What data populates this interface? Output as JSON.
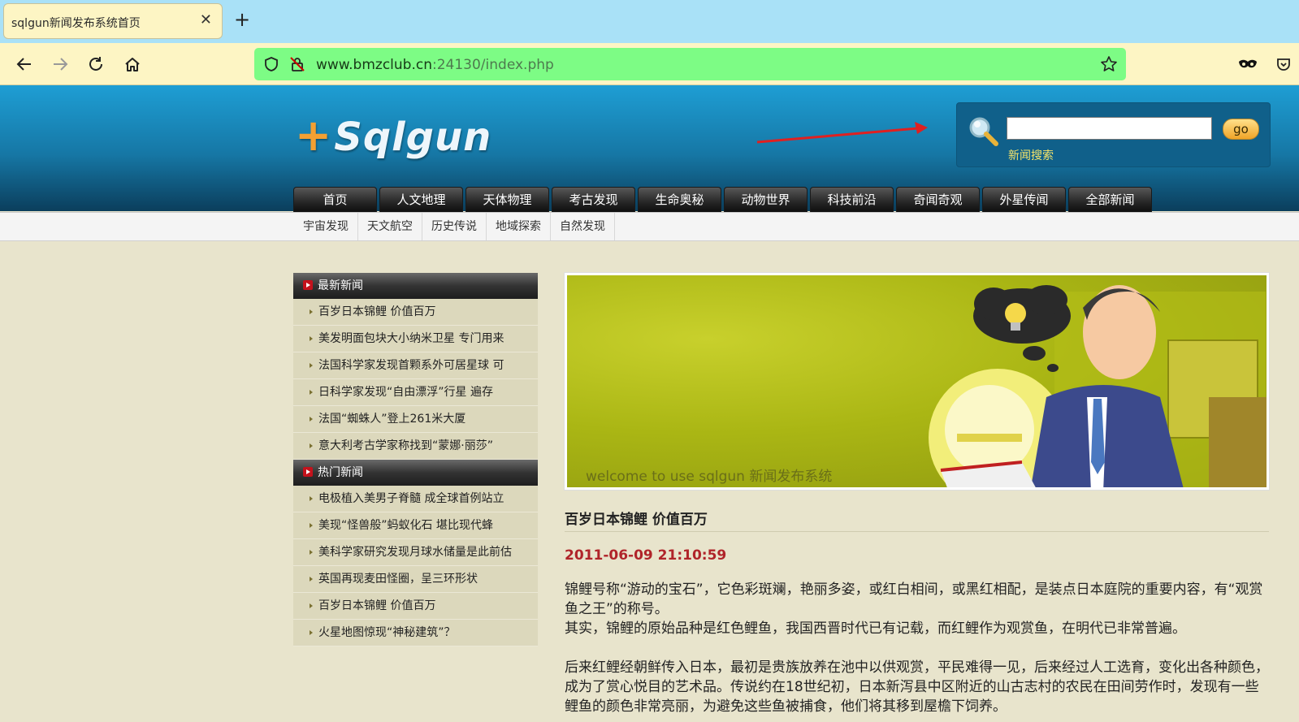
{
  "browser": {
    "tab_title": "sqlgun新闻发布系统首页",
    "tab_close": "✕",
    "new_tab": "+",
    "url_host": "www.bmzclub.cn",
    "url_rest": ":24130/index.php"
  },
  "header": {
    "logo_text": "Sqlgun",
    "logo_plus": "+",
    "search_button": "go",
    "search_label": "新闻搜索",
    "search_value": ""
  },
  "main_nav": [
    "首页",
    "人文地理",
    "天体物理",
    "考古发现",
    "生命奥秘",
    "动物世界",
    "科技前沿",
    "奇闻奇观",
    "外星传闻",
    "全部新闻"
  ],
  "sub_nav": [
    "宇宙发现",
    "天文航空",
    "历史传说",
    "地域探索",
    "自然发现"
  ],
  "sidebar": {
    "latest": {
      "title": "最新新闻",
      "items": [
        "百岁日本锦鲤 价值百万",
        "美发明面包块大小纳米卫星 专门用来",
        "法国科学家发现首颗系外可居星球 可",
        "日科学家发现“自由漂浮”行星 遍存",
        "法国“蜘蛛人”登上261米大厦",
        "意大利考古学家称找到“蒙娜·丽莎”"
      ]
    },
    "hot": {
      "title": "热门新闻",
      "items": [
        "电极植入美男子脊髓 成全球首例站立",
        "美现“怪兽般”蚂蚁化石 堪比现代蜂",
        "美科学家研究发现月球水储量是此前估",
        "英国再现麦田怪圈，呈三环形状",
        "百岁日本锦鲤 价值百万",
        "火星地图惊现“神秘建筑”？"
      ]
    }
  },
  "banner": {
    "caption": "welcome to use sqlgun 新闻发布系统"
  },
  "article": {
    "title": "百岁日本锦鲤 价值百万",
    "date": "2011-06-09 21:10:59",
    "p1": "锦鲤号称“游动的宝石”，它色彩斑斓，艳丽多姿，或红白相间，或黑红相配，是装点日本庭院的重要内容，有“观赏鱼之王”的称号。",
    "p2": "其实，锦鲤的原始品种是红色鲤鱼，我国西晋时代已有记载，而红鲤作为观赏鱼，在明代已非常普遍。",
    "p3": "后来红鲤经朝鲜传入日本，最初是贵族放养在池中以供观赏，平民难得一见，后来经过人工选育，变化出各种颜色，成为了赏心悦目的艺术品。传说约在18世纪初，日本新泻县中区附近的山古志村的农民在田间劳作时，发现有一些鲤鱼的颜色非常亮丽，为避免这些鱼被捕食，他们将其移到屋檐下饲养。"
  }
}
